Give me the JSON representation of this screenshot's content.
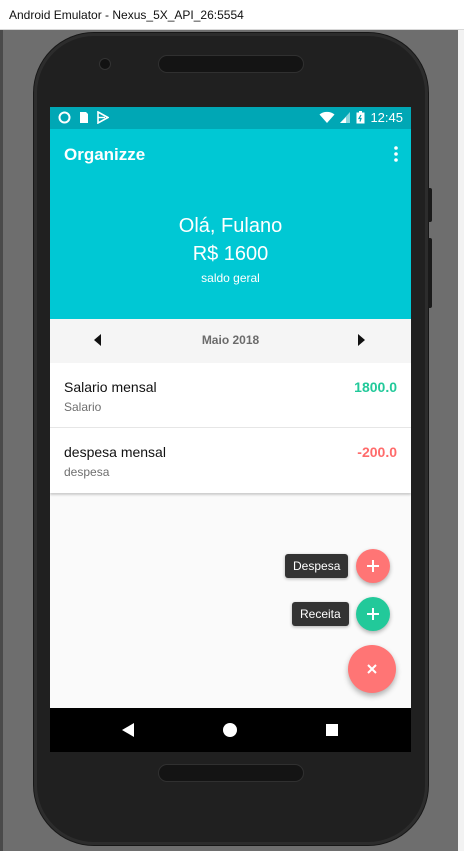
{
  "window": {
    "title": "Android Emulator - Nexus_5X_API_26:5554"
  },
  "statusbar": {
    "time": "12:45"
  },
  "appbar": {
    "title": "Organizze"
  },
  "summary": {
    "greeting": "Olá, Fulano",
    "balance": "R$ 1600",
    "balance_label": "saldo geral"
  },
  "month": {
    "label": "Maio 2018"
  },
  "transactions": [
    {
      "title": "Salario mensal",
      "category": "Salario",
      "value": "1800.0",
      "type": "receita"
    },
    {
      "title": "despesa mensal",
      "category": "despesa",
      "value": "-200.0",
      "type": "despesa"
    }
  ],
  "fab": {
    "expense_label": "Despesa",
    "income_label": "Receita"
  },
  "colors": {
    "primary": "#00c8d4",
    "primary_dark": "#00a7b5",
    "income": "#22c99a",
    "expense": "#ff6b6b"
  }
}
